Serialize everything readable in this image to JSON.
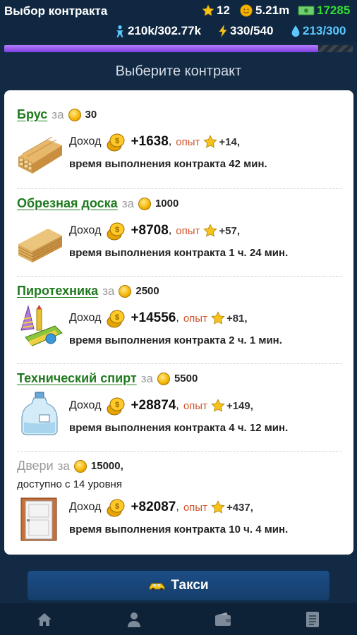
{
  "header": {
    "title": "Выбор контракта",
    "stars": "12",
    "coins": "5.21m",
    "cash": "17285",
    "population": "210k",
    "population_max": "/302.77k",
    "energy": "330",
    "energy_max": "/540",
    "water": "213/300"
  },
  "progress": {
    "fraction": 0.9
  },
  "subtitle": "Выберите контракт",
  "labels": {
    "za": "за",
    "income": "Доход",
    "exp": "опыт",
    "comma": ","
  },
  "contracts": [
    {
      "name": "Брус",
      "price": "30",
      "income": "+1638",
      "exp": "+14,",
      "time": "время выполнения контракта 42 мин.",
      "icon": "lumber-icon"
    },
    {
      "name": "Обрезная доска",
      "price": "1000",
      "income": "+8708",
      "exp": "+57,",
      "time": "время выполнения контракта 1 ч. 24 мин.",
      "icon": "planks-icon"
    },
    {
      "name": "Пиротехника",
      "price": "2500",
      "income": "+14556",
      "exp": "+81,",
      "time": "время выполнения контракта 2 ч. 1 мин.",
      "icon": "fireworks-icon"
    },
    {
      "name": "Технический спирт",
      "price": "5500",
      "income": "+28874",
      "exp": "+149,",
      "time": "время выполнения контракта 4 ч. 12 мин.",
      "icon": "bottle-icon"
    },
    {
      "name": "Двери",
      "price": "15000,",
      "available": "доступно с 14 уровня",
      "income": "+82087",
      "exp": "+437,",
      "time": "время выполнения контракта 10 ч. 4 мин.",
      "icon": "door-icon",
      "locked": true
    }
  ],
  "taxi_button": "Такси",
  "nav": [
    "home-icon",
    "profile-icon",
    "wallet-icon",
    "list-icon"
  ],
  "colors": {
    "link_green": "#1f7a1f",
    "cash_green": "#33dd33",
    "accent_blue": "#5cc8ff",
    "progress_purple": "#8f4ff0"
  }
}
